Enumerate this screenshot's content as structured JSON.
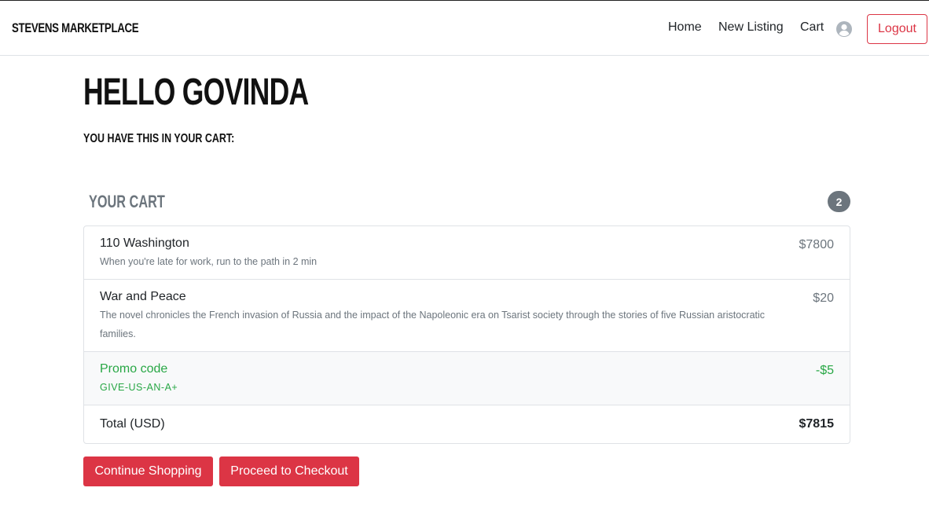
{
  "navbar": {
    "brand": "Stevens Marketplace",
    "links": {
      "home": "Home",
      "new_listing": "New Listing",
      "cart": "Cart"
    },
    "profile_icon": "user-circle-icon",
    "logout_label": "Logout"
  },
  "greeting": {
    "title": "Hello Govinda",
    "subtitle": "You have this in your cart:"
  },
  "cart": {
    "heading": "Your Cart",
    "count": "2",
    "items": [
      {
        "name": "110 Washington",
        "description": "When you're late for work, run to the path in 2 min",
        "price": "$7800"
      },
      {
        "name": "War and Peace",
        "description": "The novel chronicles the French invasion of Russia and the impact of the Napoleonic era on Tsarist society through the stories of five Russian aristocratic families.",
        "price": "$20"
      }
    ],
    "promo": {
      "label": "Promo code",
      "code": "GIVE-US-AN-A+",
      "amount": "-$5"
    },
    "total": {
      "label": "Total (USD)",
      "value": "$7815"
    }
  },
  "actions": {
    "continue_label": "Continue Shopping",
    "checkout_label": "Proceed to Checkout"
  },
  "colors": {
    "accent_red": "#dc3545",
    "promo_green": "#28a745",
    "muted_gray": "#6c757d"
  }
}
